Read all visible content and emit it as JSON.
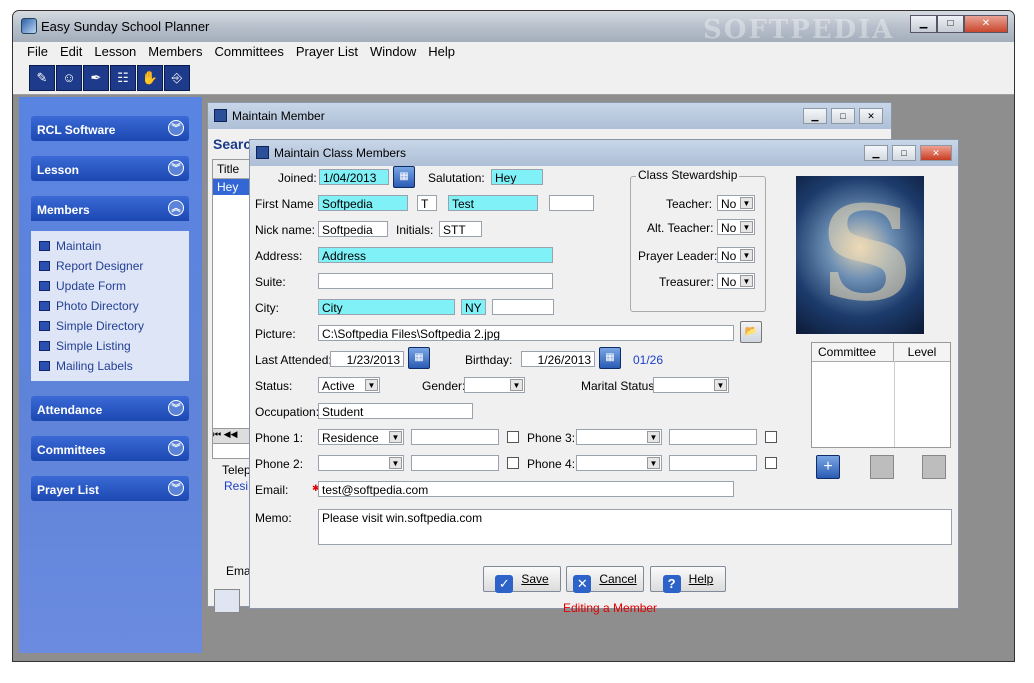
{
  "app": {
    "title": "Easy Sunday School Planner",
    "watermark": "SOFTPEDIA"
  },
  "menu": [
    "File",
    "Edit",
    "Lesson",
    "Members",
    "Committees",
    "Prayer List",
    "Window",
    "Help"
  ],
  "sidebar": {
    "sections": [
      {
        "label": "RCL Software"
      },
      {
        "label": "Lesson"
      },
      {
        "label": "Members"
      },
      {
        "label": "Attendance"
      },
      {
        "label": "Committees"
      },
      {
        "label": "Prayer List"
      }
    ],
    "members_items": [
      "Maintain",
      "Report Designer",
      "Update Form",
      "Photo Directory",
      "Simple Directory",
      "Simple Listing",
      "Mailing Labels"
    ]
  },
  "maintain_member": {
    "title": "Maintain Member",
    "search_label": "Search",
    "title_col": "Title",
    "row_value": "Hey",
    "partial_tel": "Telep",
    "partial_res": "Resi",
    "partial_ema": "Ema"
  },
  "class_members": {
    "title": "Maintain Class Members",
    "labels": {
      "joined": "Joined:",
      "salutation": "Salutation:",
      "first_name": "First Name",
      "nick_name": "Nick name:",
      "initials": "Initials:",
      "address": "Address:",
      "suite": "Suite:",
      "city": "City:",
      "picture": "Picture:",
      "last_attended": "Last Attended:",
      "birthday": "Birthday:",
      "status": "Status:",
      "gender": "Gender:",
      "marital_status": "Marital Status:",
      "occupation": "Occupation:",
      "phone1": "Phone 1:",
      "phone2": "Phone 2:",
      "phone3": "Phone 3:",
      "phone4": "Phone 4:",
      "email": "Email:",
      "memo": "Memo:"
    },
    "values": {
      "joined": "1/04/2013",
      "salutation": "Hey",
      "first_name": "Softpedia",
      "middle_initial": "T",
      "last_name": "Test",
      "nick_name": "Softpedia",
      "initials": "STT",
      "address": "Address",
      "city": "City",
      "state": "NY",
      "picture": "C:\\Softpedia Files\\Softpedia 2.jpg",
      "last_attended": "1/23/2013",
      "birthday": "1/26/2013",
      "birthday_short": "01/26",
      "status": "Active",
      "occupation": "Student",
      "phone1_type": "Residence",
      "email": "test@softpedia.com",
      "memo": "Please visit win.softpedia.com"
    },
    "stewardship": {
      "title": "Class Stewardship",
      "teacher": "Teacher:",
      "alt_teacher": "Alt. Teacher:",
      "prayer_leader": "Prayer Leader:",
      "treasurer": "Treasurer:",
      "no": "No"
    },
    "committee_table": {
      "col1": "Committee",
      "col2": "Level"
    },
    "buttons": {
      "save": "Save",
      "cancel": "Cancel",
      "help": "Help"
    },
    "status_text": "Editing a Member",
    "colors": {
      "cyan": "#7ff1f7",
      "status": "#e00000",
      "date_blue": "#1c3fc7"
    }
  }
}
